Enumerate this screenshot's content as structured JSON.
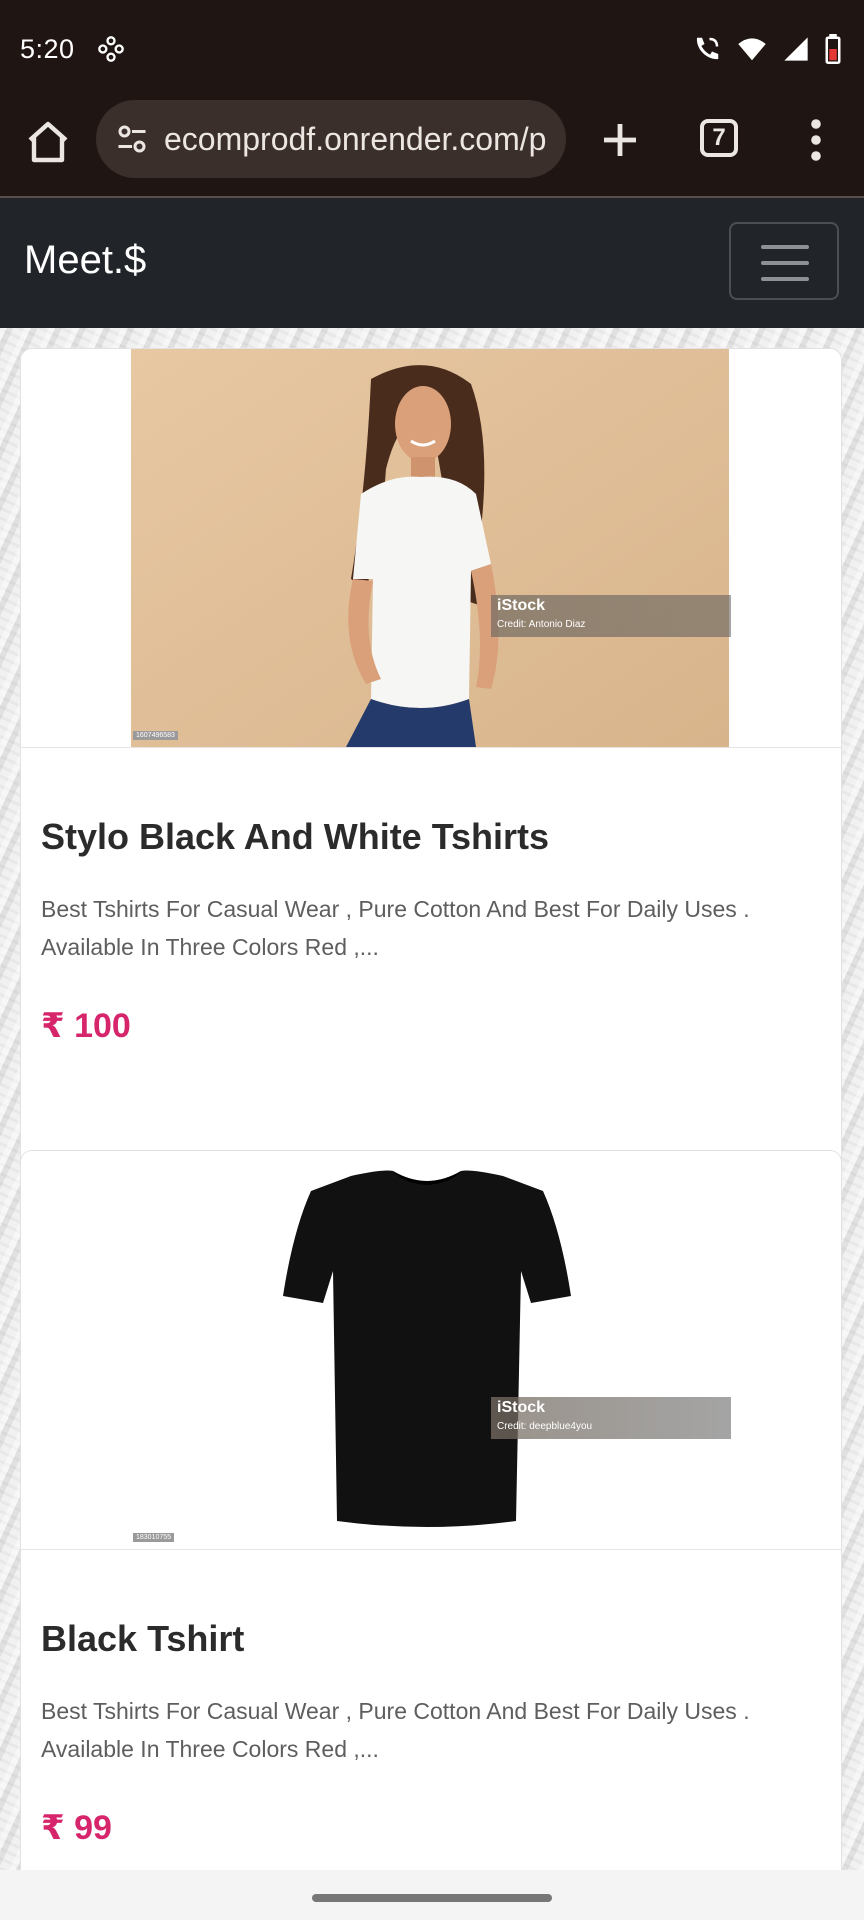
{
  "status_bar": {
    "time": "5:20",
    "icons": [
      "app-notification-icon",
      "wifi-calling-icon",
      "wifi-icon",
      "signal-icon",
      "battery-icon"
    ]
  },
  "browser": {
    "url": "ecomprodf.onrender.com/p",
    "tab_count": "7",
    "icons": [
      "home-icon",
      "site-settings-icon",
      "plus-icon",
      "more-vert-icon"
    ]
  },
  "navbar": {
    "brand": "Meet.$",
    "toggler_icon": "hamburger-icon"
  },
  "products": [
    {
      "title": "Stylo Black And White Tshirts",
      "description": "Best Tshirts For Casual Wear , Pure Cotton And Best For Daily Uses . Available In Three Colors Red ,...",
      "price": "₹ 100",
      "image": {
        "watermark": "iStock",
        "credit": "Credit: Antonio  Diaz",
        "stock_id": "1607496583"
      }
    },
    {
      "title": "Black Tshirt",
      "description": "Best Tshirts For Casual Wear , Pure Cotton And Best For Daily Uses . Available In Three Colors Red ,...",
      "price": "₹ 99",
      "image": {
        "watermark": "iStock",
        "credit": "Credit: deepblue4you",
        "stock_id": "183010755"
      }
    }
  ],
  "colors": {
    "browser_chrome": "#1f1512",
    "navbar": "#212529",
    "price": "#d6256b"
  }
}
